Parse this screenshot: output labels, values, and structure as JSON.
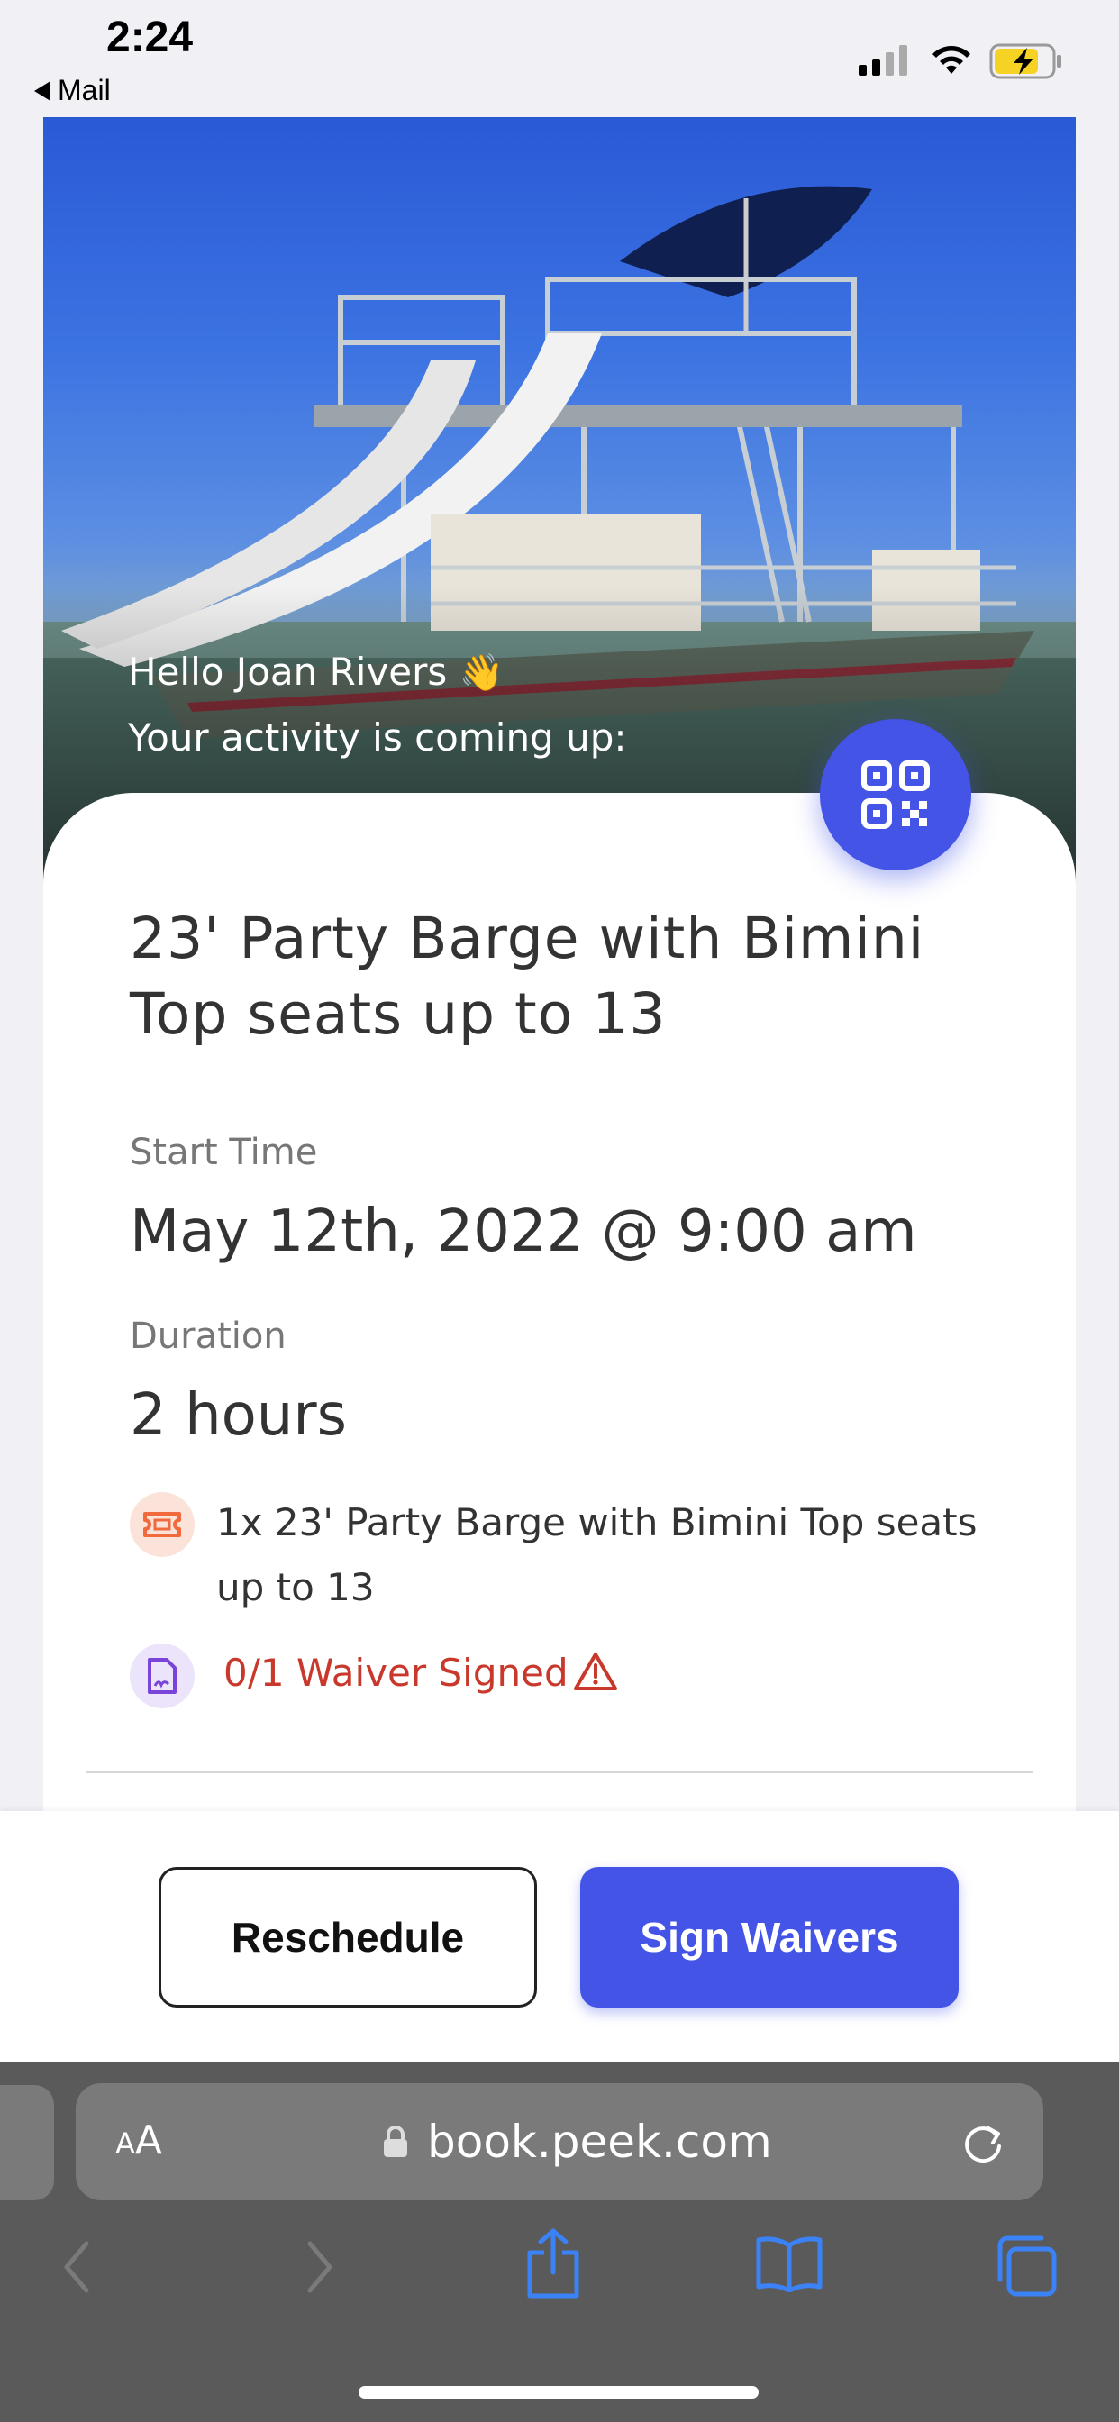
{
  "status_bar": {
    "time": "2:24",
    "back_app": "Mail"
  },
  "hero": {
    "greeting": "Hello Joan Rivers",
    "greeting_emoji": "👋",
    "subline": "Your activity is coming up:",
    "qr_icon": "qr-code-icon"
  },
  "activity": {
    "title": "23' Party Barge with Bimini Top seats up to 13",
    "start_time_label": "Start Time",
    "start_time_value": "May 12th, 2022 @ 9:00 am",
    "duration_label": "Duration",
    "duration_value": "2 hours",
    "ticket_line": "1x 23' Party Barge with Bimini Top seats up to 13",
    "waiver_status": "0/1 Waiver Signed"
  },
  "actions": {
    "reschedule": "Reschedule",
    "sign_waivers": "Sign Waivers"
  },
  "browser": {
    "aa_small": "A",
    "aa_big": "A",
    "url": "book.peek.com"
  },
  "colors": {
    "accent": "#4354e6",
    "warning": "#c9382c",
    "ticket_bg": "#fbe3d9",
    "waiver_bg": "#ebe4fb"
  }
}
